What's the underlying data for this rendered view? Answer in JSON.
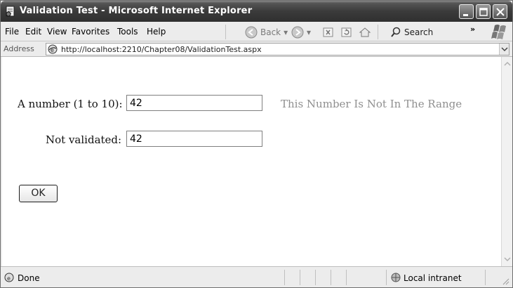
{
  "window": {
    "title": "Validation Test - Microsoft Internet Explorer"
  },
  "menu": {
    "file": "File",
    "edit": "Edit",
    "view": "View",
    "favorites": "Favorites",
    "tools": "Tools",
    "help": "Help"
  },
  "toolbar": {
    "back_label": "Back",
    "search_label": "Search",
    "overflow": "»"
  },
  "address": {
    "label": "Address",
    "url": "http://localhost:2210/Chapter08/ValidationTest.aspx"
  },
  "form": {
    "number_label": "A number (1 to 10):",
    "number_value": "42",
    "error_message": "This Number Is Not In The Range",
    "notvalidated_label": "Not validated:",
    "notvalidated_value": "42",
    "ok_label": "OK"
  },
  "status": {
    "text": "Done",
    "zone": "Local intranet"
  },
  "colors": {
    "title_bar": "#3b3b3b",
    "error_text": "#8f8f8f"
  }
}
